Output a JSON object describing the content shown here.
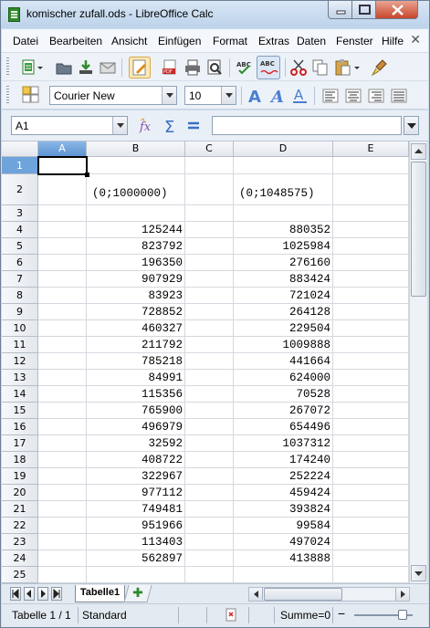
{
  "window": {
    "title": "komischer zufall.ods - LibreOffice Calc"
  },
  "menu": [
    "Datei",
    "Bearbeiten",
    "Ansicht",
    "Einfügen",
    "Format",
    "Extras",
    "Daten",
    "Fenster",
    "Hilfe"
  ],
  "formatting": {
    "font_name": "Courier New",
    "font_size": "10"
  },
  "formula_bar": {
    "cell_reference": "A1",
    "content": ""
  },
  "sheet": {
    "columns": [
      "A",
      "B",
      "C",
      "D",
      "E"
    ],
    "active_column": "A",
    "active_row": "1",
    "row_numbers": [
      "1",
      "2",
      "3",
      "4",
      "5",
      "6",
      "7",
      "8",
      "9",
      "10",
      "11",
      "12",
      "13",
      "14",
      "15",
      "16",
      "17",
      "18",
      "19",
      "20",
      "21",
      "22",
      "23",
      "24",
      "25"
    ],
    "headers": {
      "b2": "(0;1000000)",
      "d2": "(0;1048575)"
    },
    "rows": [
      {
        "row": "4",
        "b": "125244",
        "d": "880352"
      },
      {
        "row": "5",
        "b": "823792",
        "d": "1025984"
      },
      {
        "row": "6",
        "b": "196350",
        "d": "276160"
      },
      {
        "row": "7",
        "b": "907929",
        "d": "883424"
      },
      {
        "row": "8",
        "b": "83923",
        "d": "721024"
      },
      {
        "row": "9",
        "b": "728852",
        "d": "264128"
      },
      {
        "row": "10",
        "b": "460327",
        "d": "229504"
      },
      {
        "row": "11",
        "b": "211792",
        "d": "1009888"
      },
      {
        "row": "12",
        "b": "785218",
        "d": "441664"
      },
      {
        "row": "13",
        "b": "84991",
        "d": "624000"
      },
      {
        "row": "14",
        "b": "115356",
        "d": "70528"
      },
      {
        "row": "15",
        "b": "765900",
        "d": "267072"
      },
      {
        "row": "16",
        "b": "496979",
        "d": "654496"
      },
      {
        "row": "17",
        "b": "32592",
        "d": "1037312"
      },
      {
        "row": "18",
        "b": "408722",
        "d": "174240"
      },
      {
        "row": "19",
        "b": "322967",
        "d": "252224"
      },
      {
        "row": "20",
        "b": "977112",
        "d": "459424"
      },
      {
        "row": "21",
        "b": "749481",
        "d": "393824"
      },
      {
        "row": "22",
        "b": "951966",
        "d": "99584"
      },
      {
        "row": "23",
        "b": "113403",
        "d": "497024"
      },
      {
        "row": "24",
        "b": "562897",
        "d": "413888"
      }
    ]
  },
  "sheet_tabs": {
    "active": "Tabelle1"
  },
  "status_bar": {
    "sheet_position": "Tabelle 1 / 1",
    "page_style": "Standard",
    "sum": "Summe=0"
  },
  "colors": {
    "selection_header": "#6fa3dc",
    "window_frame": "#c7d8ea"
  }
}
